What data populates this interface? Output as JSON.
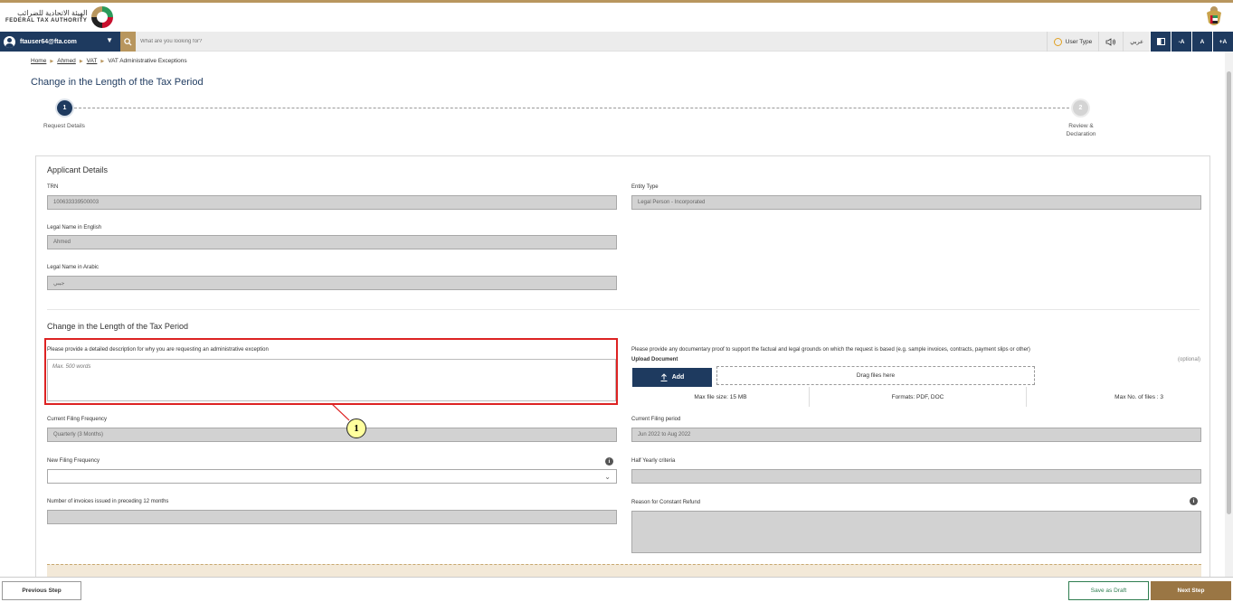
{
  "header": {
    "logo_ar": "الهيئة الاتحادية للضرائب",
    "logo_en": "FEDERAL TAX AUTHORITY"
  },
  "navbar": {
    "user_email": "ftauser64@fta.com",
    "search_placeholder": "What are you looking for?",
    "user_type": "User Type",
    "language": "عربي",
    "font_decrease": "-A",
    "font_normal": "A",
    "font_increase": "+A"
  },
  "breadcrumb": {
    "items": [
      "Home",
      "Ahmed",
      "VAT"
    ],
    "current": "VAT Administrative Exceptions"
  },
  "page_title": "Change in the Length of the Tax Period",
  "stepper": {
    "step1": {
      "number": "1",
      "label": "Request Details"
    },
    "step2": {
      "number": "2",
      "label_line1": "Review &",
      "label_line2": "Declaration"
    }
  },
  "applicant": {
    "title": "Applicant Details",
    "trn_label": "TRN",
    "trn_value": "100633339500003",
    "entity_label": "Entity Type",
    "entity_value": "Legal Person - Incorporated",
    "name_en_label": "Legal Name in English",
    "name_en_value": "Ahmed",
    "name_ar_label": "Legal Name in Arabic",
    "name_ar_value": "جيبي"
  },
  "change_section": {
    "title": "Change in the Length of the Tax Period",
    "description_label": "Please provide a detailed description for why you are requesting an administrative exception",
    "description_placeholder": "Max. 500 words",
    "proof_label": "Please provide any documentary proof to support the factual and legal grounds on which the request is based (e.g. sample invoices, contracts, payment slips or other)",
    "upload_label": "Upload Document",
    "optional": "(optional)",
    "add_button": "Add",
    "drop_text": "Drag files here",
    "max_size": "Max file size: 15 MB",
    "formats": "Formats: PDF, DOC",
    "max_files": "Max No. of files : 3",
    "current_freq_label": "Current Filing Frequency",
    "current_freq_value": "Quarterly (3 Months)",
    "current_period_label": "Current Filing period",
    "current_period_value": "Jun 2022 to Aug 2022",
    "new_freq_label": "New Filing Frequency",
    "new_freq_value": "",
    "half_yearly_label": "Half Yearly criteria",
    "invoices_label": "Number of invoices issued in preceding 12 months",
    "refund_label": "Reason for Constant Refund"
  },
  "callout": {
    "number": "1"
  },
  "footer": {
    "previous": "Previous Step",
    "save_draft": "Save as Draft",
    "next": "Next Step"
  },
  "colors": {
    "primary": "#1e3a5f",
    "accent": "#b8965e",
    "next_button": "#9a7644",
    "draft_border": "#2e7d4f",
    "highlight": "#dd2222"
  },
  "icons": [
    "user-icon",
    "chevron-down-icon",
    "search-icon",
    "user-type-icon",
    "speaker-icon",
    "contrast-icon",
    "upload-icon",
    "info-icon",
    "uae-emblem-icon"
  ]
}
